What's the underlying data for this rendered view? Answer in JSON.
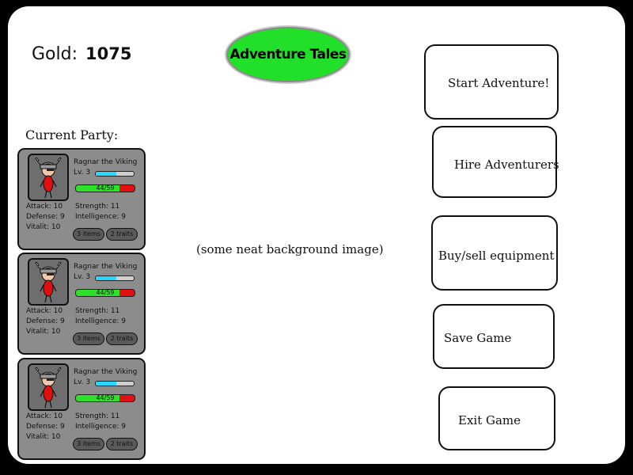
{
  "gold": {
    "label": "Gold:",
    "value": "1075"
  },
  "title": "Adventure Tales",
  "party": {
    "label": "Current Party:",
    "members": [
      {
        "name": "Ragnar the Viking",
        "level": "Lv. 3",
        "xp_fraction": 0.55,
        "hp_text": "44/59",
        "hp_fraction": 0.746,
        "attack": "Attack: 10",
        "defense": "Defense: 9",
        "vitality": "Vitalit: 10",
        "strength": "Strength: 11",
        "intelligence": "Intelligence: 9",
        "items": "3 items",
        "traits": "2 traits"
      },
      {
        "name": "Ragnar the Viking",
        "level": "Lv. 3",
        "xp_fraction": 0.55,
        "hp_text": "44/59",
        "hp_fraction": 0.746,
        "attack": "Attack: 10",
        "defense": "Defense: 9",
        "vitality": "Vitalit: 10",
        "strength": "Strength: 11",
        "intelligence": "Intelligence: 9",
        "items": "3 items",
        "traits": "2 traits"
      },
      {
        "name": "Ragnar the Viking",
        "level": "Lv. 3",
        "xp_fraction": 0.55,
        "hp_text": "44/59",
        "hp_fraction": 0.746,
        "attack": "Attack: 10",
        "defense": "Defense: 9",
        "vitality": "Vitalit: 10",
        "strength": "Strength: 11",
        "intelligence": "Intelligence: 9",
        "items": "3 items",
        "traits": "2 traits"
      }
    ]
  },
  "background_note": "(some neat background image)",
  "menu": {
    "start": "Start Adventure!",
    "hire": "Hire Adventurers",
    "buy_sell": "Buy/sell equipment",
    "save": "Save Game",
    "exit": "Exit Game"
  },
  "colors": {
    "title_badge": "#22e02a",
    "card_bg": "#8c8c8c",
    "hp_fill": "#2ee02a",
    "hp_empty": "#e21010",
    "xp_fill": "#2ad7ff"
  }
}
